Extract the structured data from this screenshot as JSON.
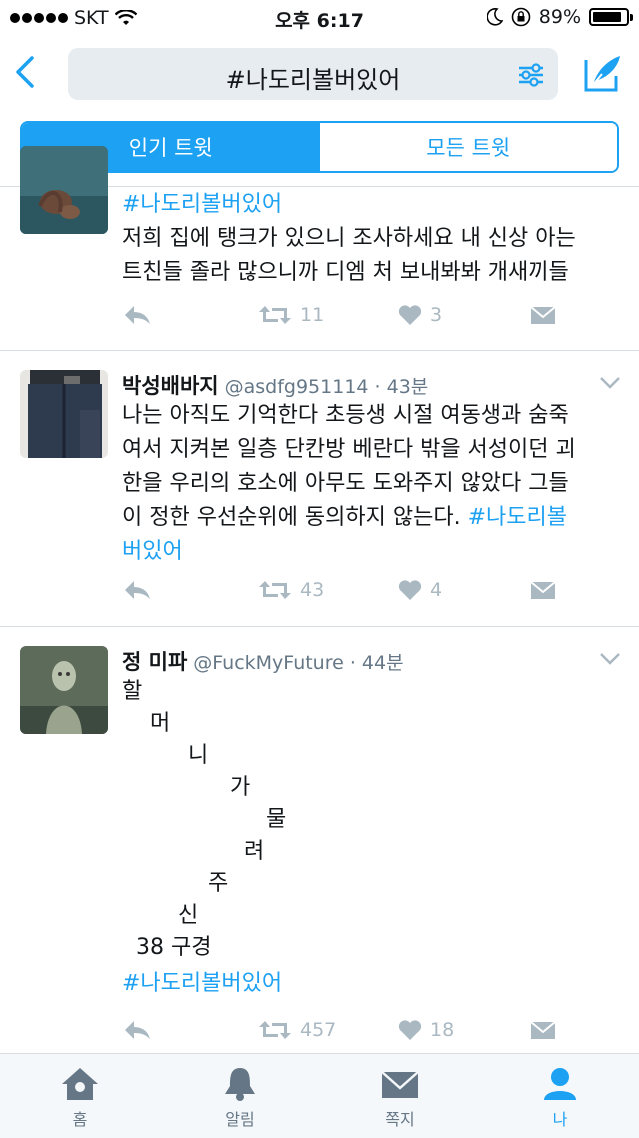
{
  "status_bar": {
    "carrier": "SKT",
    "time": "오후 6:17",
    "battery": "89%",
    "battery_level": 0.89
  },
  "nav": {
    "search_query": "#나도리볼버있어"
  },
  "segments": {
    "top": "인기 트윗",
    "all": "모든 트윗"
  },
  "tweets": [
    {
      "body_text": "저희 집에 탱크가 있으니 조사하세요 내 신상 아는\n트친들 졸라 많으니까 디엠 처 보내봐봐 개새끼들",
      "hashtag": "#나도리볼버있어",
      "retweets": "11",
      "likes": "3"
    },
    {
      "name": "박성배바지",
      "handle": "@asdfg951114 · 43분",
      "body_text": "나는 아직도 기억한다 초등생 시절 여동생과 숨죽\n여서 지켜본 일층 단칸방 베란다 밖을 서성이던 괴\n한을 우리의 호소에 아무도 도와주지 않았다 그들\n이 정한 우선순위에 동의하지 않는다. ",
      "hashtag_line1": "#나도리볼",
      "hashtag_line2": "버있어",
      "retweets": "43",
      "likes": "4"
    },
    {
      "name": "정 미파",
      "handle": "@FuckMyFuture · 44분",
      "poem": [
        "할",
        "머",
        "니",
        "가",
        "물",
        "려",
        "주",
        "신",
        "38 구경"
      ],
      "hashtag": "#나도리볼버있어",
      "retweets": "457",
      "likes": "18"
    }
  ],
  "tab_bar": {
    "home": "홈",
    "notifications": "알림",
    "messages": "쪽지",
    "me": "나"
  },
  "colors": {
    "accent": "#1da1f2",
    "icon_gray": "#aab8c2",
    "text": "#14171a",
    "secondary": "#657786"
  },
  "icons": [
    "chevron-left-icon",
    "filter-icon",
    "compose-icon",
    "reply-icon",
    "retweet-icon",
    "heart-icon",
    "dm-icon",
    "home-icon",
    "bell-icon",
    "envelope-icon",
    "person-icon"
  ]
}
